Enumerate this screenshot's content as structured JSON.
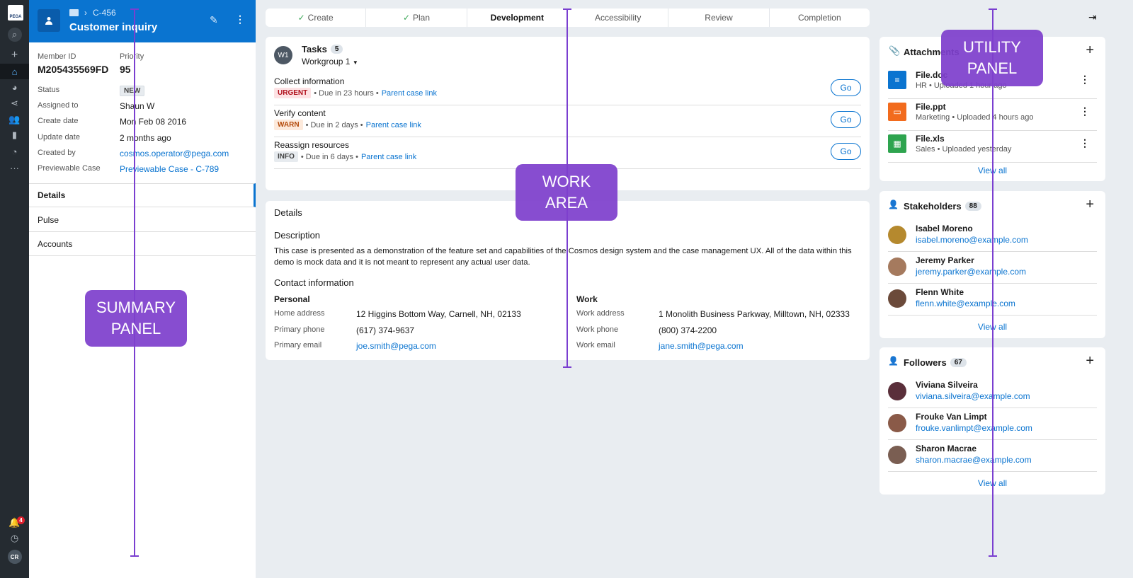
{
  "nav": {
    "logo": "PEGA",
    "items": [
      "search-icon",
      "plus-icon",
      "home-icon",
      "dashboard-icon",
      "share-icon",
      "users-icon",
      "book-icon",
      "gauge-icon",
      "more-icon"
    ],
    "notification_count": "4",
    "avatar": "CR"
  },
  "summary": {
    "breadcrumb_id": "C-456",
    "title": "Customer inquiry",
    "member_id_label": "Member ID",
    "member_id": "M205435569FD",
    "priority_label": "Priority",
    "priority": "95",
    "fields": [
      {
        "label": "Status",
        "value": "NEW"
      },
      {
        "label": "Assigned to",
        "value": "Shaun W"
      },
      {
        "label": "Create date",
        "value": "Mon Feb 08 2016"
      },
      {
        "label": "Update date",
        "value": "2 months ago"
      },
      {
        "label": "Created by",
        "value": "cosmos.operator@pega.com"
      },
      {
        "label": "Previewable Case",
        "value": "Previewable Case - C-789"
      }
    ],
    "tabs": [
      "Details",
      "Pulse",
      "Accounts"
    ]
  },
  "stages": [
    {
      "label": "Create",
      "done": true
    },
    {
      "label": "Plan",
      "done": true
    },
    {
      "label": "Development",
      "current": true
    },
    {
      "label": "Accessibility"
    },
    {
      "label": "Review"
    },
    {
      "label": "Completion"
    }
  ],
  "tasks": {
    "avatar": "W1",
    "title": "Tasks",
    "count": "5",
    "workgroup": "Workgroup 1",
    "items": [
      {
        "name": "Collect information",
        "badge": "URGENT",
        "due": "• Due in 23 hours •",
        "link": "Parent case link",
        "go": "Go"
      },
      {
        "name": "Verify content",
        "badge": "WARN",
        "due": "• Due in 2 days •",
        "link": "Parent case link",
        "go": "Go"
      },
      {
        "name": "Reassign resources",
        "badge": "INFO",
        "due": "• Due in 6 days •",
        "link": "Parent case link",
        "go": "Go"
      }
    ]
  },
  "details": {
    "title": "Details",
    "description_heading": "Description",
    "description": "This case is presented as a demonstration of the feature set and capabilities of the Cosmos design system and the case management UX. All of the data within this demo is mock data and it is not meant to represent any actual user data.",
    "contact_heading": "Contact information",
    "personal": {
      "heading": "Personal",
      "rows": [
        {
          "label": "Home address",
          "value": "12 Higgins Bottom Way, Carnell, NH, 02133"
        },
        {
          "label": "Primary phone",
          "value": "(617) 374-9637"
        },
        {
          "label": "Primary email",
          "value": "joe.smith@pega.com"
        }
      ]
    },
    "work": {
      "heading": "Work",
      "rows": [
        {
          "label": "Work address",
          "value": "1 Monolith Business Parkway, Milltown, NH, 02333"
        },
        {
          "label": "Work phone",
          "value": "(800) 374-2200"
        },
        {
          "label": "Work email",
          "value": "jane.smith@pega.com"
        }
      ]
    }
  },
  "attachments": {
    "title": "Attachments",
    "view_all": "View all",
    "files": [
      {
        "name": "File.doc",
        "meta": "HR • Uploaded 1 hour ago",
        "color": "#0a74d0"
      },
      {
        "name": "File.ppt",
        "meta": "Marketing • Uploaded 4 hours ago",
        "color": "#f26b1d"
      },
      {
        "name": "File.xls",
        "meta": "Sales • Uploaded yesterday",
        "color": "#2ea44f"
      }
    ]
  },
  "stakeholders": {
    "title": "Stakeholders",
    "count": "88",
    "view_all": "View all",
    "people": [
      {
        "name": "Isabel Moreno",
        "email": "isabel.moreno@example.com"
      },
      {
        "name": "Jeremy Parker",
        "email": "jeremy.parker@example.com"
      },
      {
        "name": "Flenn White",
        "email": "flenn.white@example.com"
      }
    ]
  },
  "followers": {
    "title": "Followers",
    "count": "67",
    "view_all": "View all",
    "people": [
      {
        "name": "Viviana Silveira",
        "email": "viviana.silveira@example.com"
      },
      {
        "name": "Frouke Van Limpt",
        "email": "frouke.vanlimpt@example.com"
      },
      {
        "name": "Sharon Macrae",
        "email": "sharon.macrae@example.com"
      }
    ]
  },
  "callouts": {
    "summary": [
      "SUMMARY",
      "PANEL"
    ],
    "work": [
      "WORK",
      "AREA"
    ],
    "utility": [
      "UTILITY",
      "PANEL"
    ]
  },
  "colors": {
    "brand": "#0a74d0",
    "callout": "#7e40cc",
    "nav": "#252b31"
  }
}
